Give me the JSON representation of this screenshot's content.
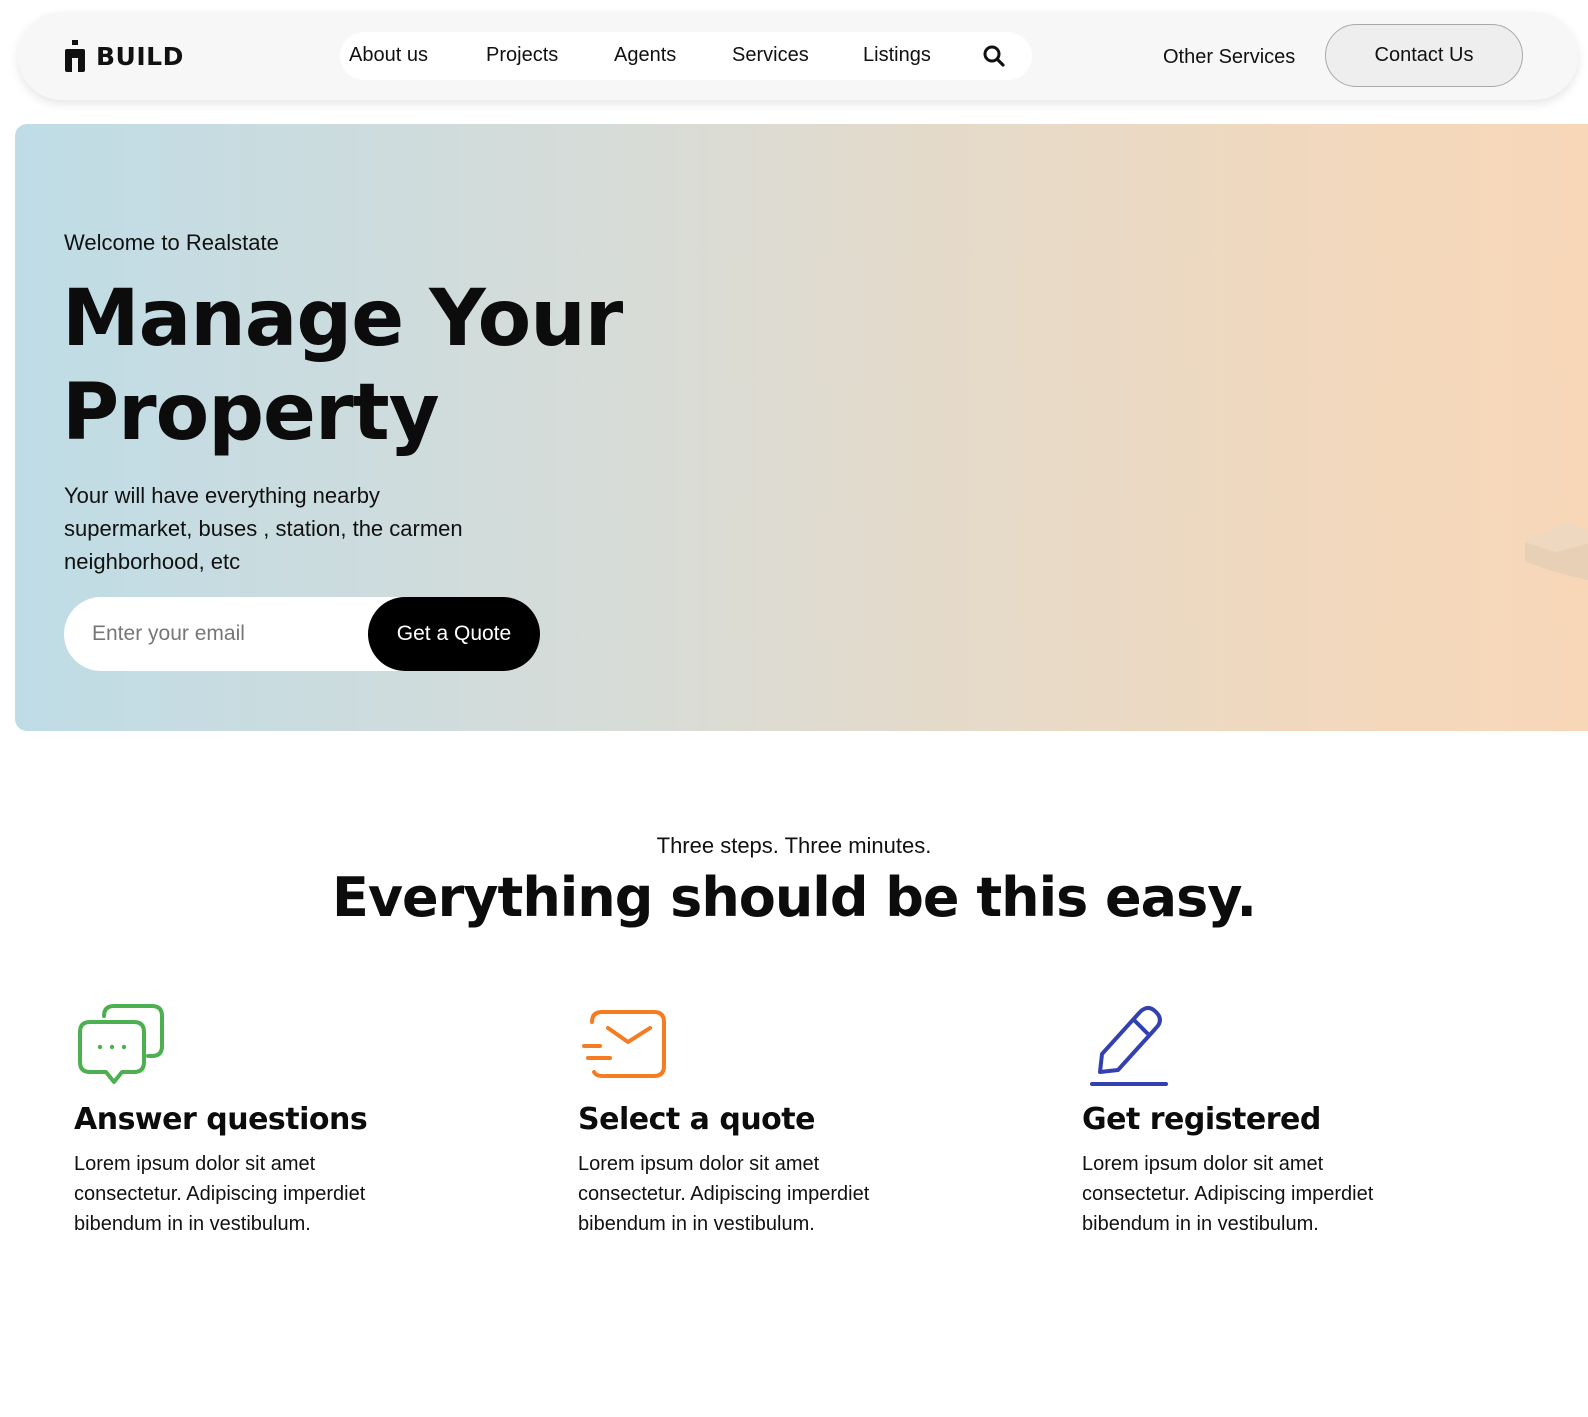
{
  "navbar": {
    "brand": "BUILD",
    "links": [
      "About us",
      "Projects",
      "Agents",
      "Services",
      "Listings"
    ],
    "other_services": "Other Services",
    "contact_button": "Contact Us"
  },
  "hero": {
    "eyebrow": "Welcome to Realstate",
    "title_line1": "Manage Your",
    "title_line2": "Property",
    "description": "Your will have everything nearby supermarket, buses , station, the carmen neighborhood, etc",
    "email_placeholder": "Enter your email",
    "quote_button": "Get a Quote"
  },
  "steps_section": {
    "eyebrow": "Three steps. Three minutes.",
    "title": "Everything should be this easy.",
    "steps": [
      {
        "title": "Answer questions",
        "description": "Lorem ipsum dolor sit amet consectetur. Adipiscing imperdiet bibendum in in vestibulum.",
        "icon": "chat-bubbles-icon",
        "color": "#4caf50"
      },
      {
        "title": "Select a quote",
        "description": "Lorem ipsum dolor sit amet consectetur. Adipiscing imperdiet bibendum in in vestibulum.",
        "icon": "envelope-send-icon",
        "color": "#f57c20"
      },
      {
        "title": "Get registered",
        "description": "Lorem ipsum dolor sit amet consectetur. Adipiscing imperdiet bibendum in in vestibulum.",
        "icon": "pencil-icon",
        "color": "#3341b0"
      }
    ]
  }
}
